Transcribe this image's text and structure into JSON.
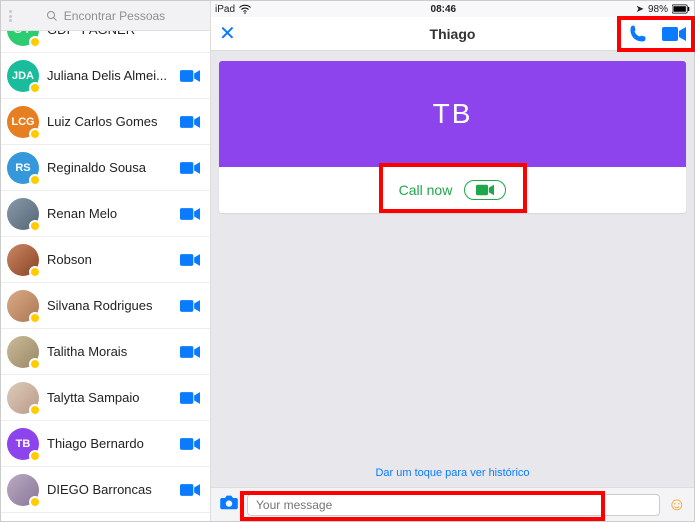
{
  "statusbar": {
    "carrier": "iPad",
    "time": "08:46",
    "battery": "98%"
  },
  "search": {
    "placeholder": "Encontrar Pessoas"
  },
  "contacts": [
    {
      "initials": "G-F",
      "name": "GDI - FAGNER",
      "avatarClass": "c-green",
      "hasCam": false,
      "badge": true
    },
    {
      "initials": "JDA",
      "name": "Juliana Delis Almei...",
      "avatarClass": "c-teal",
      "hasCam": true,
      "badge": true
    },
    {
      "initials": "LCG",
      "name": "Luiz Carlos Gomes",
      "avatarClass": "c-orange",
      "hasCam": true,
      "badge": true
    },
    {
      "initials": "RS",
      "name": "Reginaldo Sousa",
      "avatarClass": "c-blue",
      "hasCam": true,
      "badge": true
    },
    {
      "initials": "",
      "name": "Renan Melo",
      "avatarClass": "photo",
      "hasCam": true,
      "badge": true,
      "photo": "linear-gradient(135deg,#8899aa,#556677)"
    },
    {
      "initials": "",
      "name": "Robson",
      "avatarClass": "photo",
      "hasCam": true,
      "badge": true,
      "photo": "linear-gradient(135deg,#cc8866,#884422)"
    },
    {
      "initials": "",
      "name": "Silvana Rodrigues",
      "avatarClass": "photo",
      "hasCam": true,
      "badge": true,
      "photo": "linear-gradient(135deg,#ddaa88,#aa7755)"
    },
    {
      "initials": "",
      "name": "Talitha Morais",
      "avatarClass": "photo",
      "hasCam": true,
      "badge": true,
      "photo": "linear-gradient(135deg,#ccbb99,#998866)"
    },
    {
      "initials": "",
      "name": "Talytta Sampaio",
      "avatarClass": "photo",
      "hasCam": true,
      "badge": true,
      "photo": "linear-gradient(135deg,#ddccbb,#bb9988)"
    },
    {
      "initials": "TB",
      "name": "Thiago Bernardo",
      "avatarClass": "c-purple",
      "hasCam": true,
      "badge": true
    },
    {
      "initials": "",
      "name": "DIEGO Barroncas",
      "avatarClass": "photo",
      "hasCam": true,
      "badge": true,
      "photo": "linear-gradient(135deg,#bbaac0,#887799)"
    }
  ],
  "chat": {
    "title": "Thiago",
    "initials": "TB",
    "callLabel": "Call now",
    "historyHint": "Dar um toque para ver histórico",
    "inputPlaceholder": "Your message"
  }
}
